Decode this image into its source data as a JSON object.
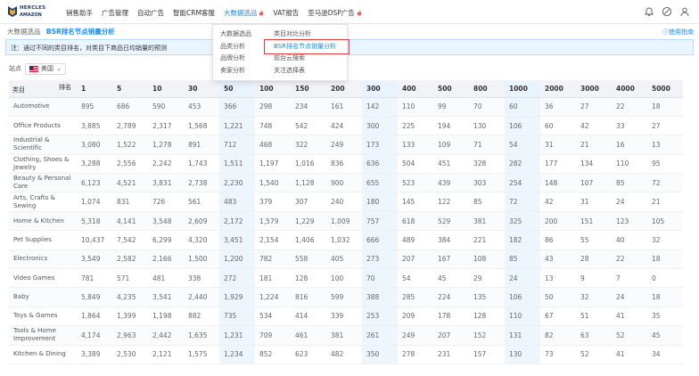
{
  "logo": {
    "brand": "HERCLES",
    "sub": "AMAZON"
  },
  "nav": [
    {
      "label": "销售助手",
      "active": false,
      "hot": false
    },
    {
      "label": "广告管理",
      "active": false,
      "hot": false
    },
    {
      "label": "自动广告",
      "active": false,
      "hot": false
    },
    {
      "label": "智能CRM客服",
      "active": false,
      "hot": false
    },
    {
      "label": "大数据选品",
      "active": true,
      "hot": true
    },
    {
      "label": "VAT报告",
      "active": false,
      "hot": false
    },
    {
      "label": "亚马逊DSP广告",
      "active": false,
      "hot": true
    }
  ],
  "top_icons": [
    "bell-icon",
    "help-circle-icon",
    "user-icon"
  ],
  "breadcrumb": {
    "parent": "大数据选品",
    "current": "BSR排名节点销量分析"
  },
  "help_link": "使用指南",
  "notice": "注：通过不同的类目排名，对类目下商品日均销量的预测",
  "site": {
    "label": "站点",
    "value": "美国"
  },
  "dropdown": {
    "col1": [
      "大数据选品",
      "品类分析",
      "品牌分析",
      "卖家分析"
    ],
    "col2": [
      "类目对比分析",
      "BSR排名节点销量分析",
      "前台云搜索",
      "关注选择表"
    ],
    "selected": "BSR排名节点销量分析"
  },
  "table": {
    "corner": {
      "row_label": "类目",
      "col_label": "排名"
    },
    "ranks": [
      "1",
      "5",
      "10",
      "30",
      "50",
      "100",
      "150",
      "200",
      "300",
      "400",
      "500",
      "800",
      "1000",
      "2000",
      "3000",
      "4000",
      "5000"
    ],
    "rows": [
      {
        "category": "Automotive",
        "values": [
          "895",
          "686",
          "590",
          "453",
          "366",
          "298",
          "234",
          "161",
          "142",
          "110",
          "99",
          "70",
          "60",
          "36",
          "27",
          "22",
          "18"
        ]
      },
      {
        "category": "Office Products",
        "values": [
          "3,885",
          "2,789",
          "2,317",
          "1,568",
          "1,221",
          "748",
          "542",
          "424",
          "300",
          "225",
          "194",
          "130",
          "106",
          "60",
          "42",
          "33",
          "27"
        ]
      },
      {
        "category": "Industrial & Scientific",
        "values": [
          "3,080",
          "1,522",
          "1,278",
          "891",
          "712",
          "468",
          "322",
          "249",
          "173",
          "133",
          "109",
          "71",
          "54",
          "31",
          "21",
          "16",
          "13"
        ]
      },
      {
        "category": "Clothing, Shoes & Jewelry",
        "values": [
          "3,288",
          "2,556",
          "2,242",
          "1,743",
          "1,511",
          "1,197",
          "1,016",
          "836",
          "636",
          "504",
          "451",
          "328",
          "282",
          "177",
          "134",
          "110",
          "95"
        ]
      },
      {
        "category": "Beauty & Personal Care",
        "values": [
          "6,123",
          "4,521",
          "3,831",
          "2,738",
          "2,230",
          "1,540",
          "1,128",
          "900",
          "655",
          "523",
          "439",
          "303",
          "254",
          "148",
          "107",
          "85",
          "72"
        ]
      },
      {
        "category": "Arts, Crafts & Sewing",
        "values": [
          "1,074",
          "831",
          "726",
          "561",
          "483",
          "379",
          "307",
          "240",
          "180",
          "145",
          "122",
          "85",
          "72",
          "42",
          "31",
          "24",
          "21"
        ]
      },
      {
        "category": "Home & Kitchen",
        "values": [
          "5,318",
          "4,141",
          "3,548",
          "2,609",
          "2,172",
          "1,579",
          "1,229",
          "1,009",
          "757",
          "618",
          "529",
          "381",
          "325",
          "200",
          "151",
          "123",
          "105"
        ]
      },
      {
        "category": "Pet Supplies",
        "values": [
          "10,437",
          "7,542",
          "6,299",
          "4,320",
          "3,451",
          "2,154",
          "1,406",
          "1,032",
          "666",
          "489",
          "384",
          "221",
          "182",
          "86",
          "55",
          "40",
          "32"
        ]
      },
      {
        "category": "Electronics",
        "values": [
          "3,549",
          "2,582",
          "2,166",
          "1,500",
          "1,200",
          "782",
          "558",
          "405",
          "273",
          "207",
          "167",
          "108",
          "85",
          "43",
          "28",
          "22",
          "18"
        ]
      },
      {
        "category": "Video Games",
        "values": [
          "781",
          "571",
          "481",
          "338",
          "272",
          "181",
          "128",
          "100",
          "70",
          "54",
          "45",
          "29",
          "24",
          "13",
          "9",
          "7",
          "0"
        ]
      },
      {
        "category": "Baby",
        "values": [
          "5,849",
          "4,235",
          "3,541",
          "2,440",
          "1,929",
          "1,224",
          "816",
          "599",
          "388",
          "285",
          "224",
          "135",
          "106",
          "50",
          "32",
          "24",
          "18"
        ]
      },
      {
        "category": "Toys & Games",
        "values": [
          "1,864",
          "1,399",
          "1,198",
          "882",
          "735",
          "534",
          "414",
          "339",
          "253",
          "209",
          "178",
          "128",
          "110",
          "67",
          "51",
          "41",
          "35"
        ]
      },
      {
        "category": "Tools & Home Improvement",
        "values": [
          "4,174",
          "2,963",
          "2,442",
          "1,635",
          "1,231",
          "709",
          "461",
          "381",
          "261",
          "249",
          "207",
          "152",
          "131",
          "82",
          "63",
          "52",
          "45"
        ]
      },
      {
        "category": "Kitchen & Dining",
        "values": [
          "3,389",
          "2,530",
          "2,121",
          "1,575",
          "1,234",
          "852",
          "623",
          "482",
          "350",
          "278",
          "231",
          "157",
          "130",
          "73",
          "52",
          "41",
          "34"
        ]
      }
    ]
  },
  "colors": {
    "accent": "#1a8cff",
    "highlight_col": "#e9f3fc",
    "dropdown_outline": "#e0393e",
    "hot": "#ff5a3c"
  }
}
